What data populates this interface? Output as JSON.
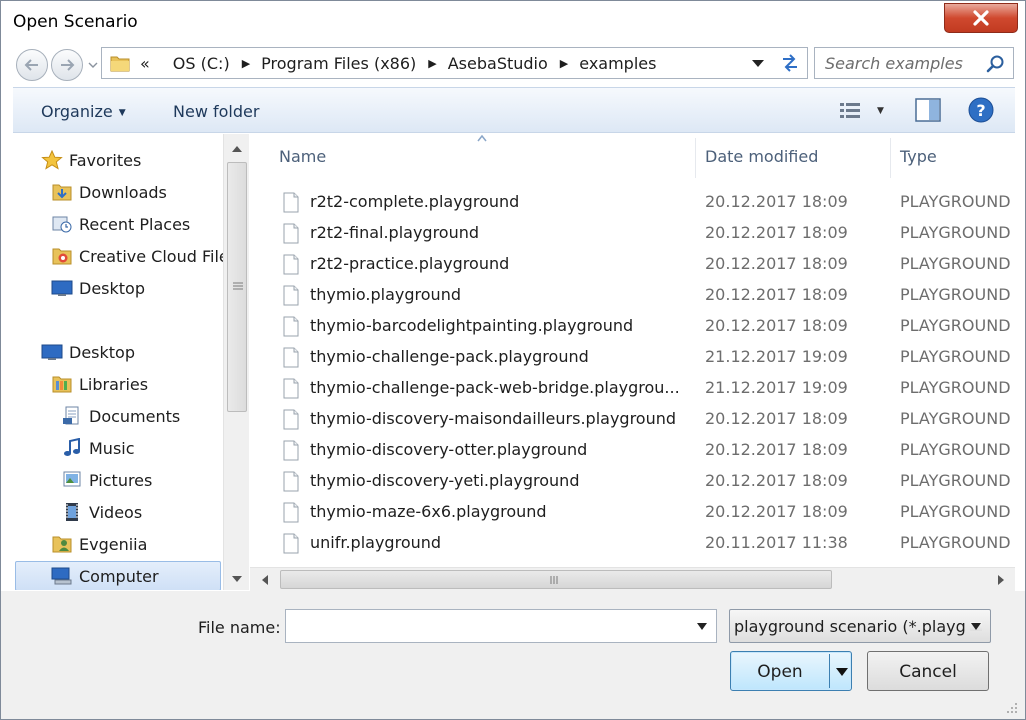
{
  "window": {
    "title": "Open Scenario",
    "close_icon": "close-icon"
  },
  "address": {
    "overflow": "«",
    "crumbs": [
      "OS (C:)",
      "Program Files (x86)",
      "AsebaStudio",
      "examples"
    ]
  },
  "search": {
    "placeholder": "Search examples"
  },
  "toolbar": {
    "organize": "Organize",
    "new_folder": "New folder"
  },
  "nav": {
    "favorites": "Favorites",
    "downloads": "Downloads",
    "recent_places": "Recent Places",
    "creative_cloud": "Creative Cloud Files",
    "desktop_fav": "Desktop",
    "desktop": "Desktop",
    "libraries": "Libraries",
    "documents": "Documents",
    "music": "Music",
    "pictures": "Pictures",
    "videos": "Videos",
    "user": "Evgeniia",
    "computer": "Computer"
  },
  "columns": {
    "name": "Name",
    "date": "Date modified",
    "type": "Type"
  },
  "files": [
    {
      "name": "r2t2-complete.playground",
      "date": "20.12.2017 18:09",
      "type": "PLAYGROUND"
    },
    {
      "name": "r2t2-final.playground",
      "date": "20.12.2017 18:09",
      "type": "PLAYGROUND"
    },
    {
      "name": "r2t2-practice.playground",
      "date": "20.12.2017 18:09",
      "type": "PLAYGROUND"
    },
    {
      "name": "thymio.playground",
      "date": "20.12.2017 18:09",
      "type": "PLAYGROUND"
    },
    {
      "name": "thymio-barcodelightpainting.playground",
      "date": "20.12.2017 18:09",
      "type": "PLAYGROUND"
    },
    {
      "name": "thymio-challenge-pack.playground",
      "date": "21.12.2017 19:09",
      "type": "PLAYGROUND"
    },
    {
      "name": "thymio-challenge-pack-web-bridge.playgrou...",
      "date": "21.12.2017 19:09",
      "type": "PLAYGROUND"
    },
    {
      "name": "thymio-discovery-maisondailleurs.playground",
      "date": "20.12.2017 18:09",
      "type": "PLAYGROUND"
    },
    {
      "name": "thymio-discovery-otter.playground",
      "date": "20.12.2017 18:09",
      "type": "PLAYGROUND"
    },
    {
      "name": "thymio-discovery-yeti.playground",
      "date": "20.12.2017 18:09",
      "type": "PLAYGROUND"
    },
    {
      "name": "thymio-maze-6x6.playground",
      "date": "20.12.2017 18:09",
      "type": "PLAYGROUND"
    },
    {
      "name": "unifr.playground",
      "date": "20.11.2017 11:38",
      "type": "PLAYGROUND"
    }
  ],
  "bottom": {
    "file_name_label": "File name:",
    "file_name_value": "",
    "file_type": "playground scenario (*.playg",
    "open": "Open",
    "cancel": "Cancel"
  }
}
